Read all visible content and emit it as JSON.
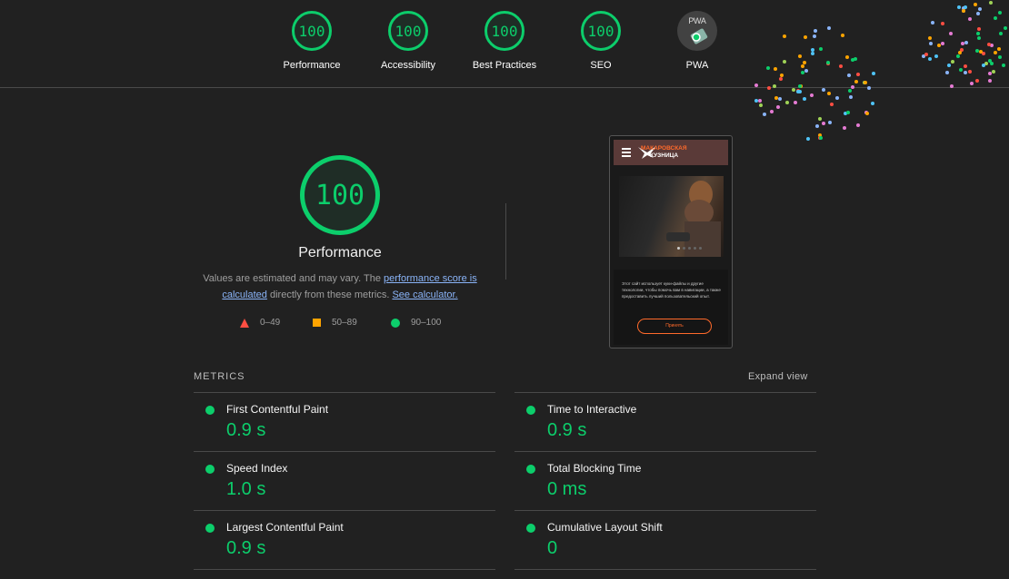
{
  "top_scores": [
    {
      "score": "100",
      "label": "Performance"
    },
    {
      "score": "100",
      "label": "Accessibility"
    },
    {
      "score": "100",
      "label": "Best Practices"
    },
    {
      "score": "100",
      "label": "SEO"
    }
  ],
  "pwa": {
    "label": "PWA",
    "badge_text": "PWA"
  },
  "performance": {
    "score": "100",
    "title": "Performance",
    "desc_prefix": "Values are estimated and may vary. The ",
    "desc_link1": "performance score is calculated",
    "desc_mid": " directly from these metrics. ",
    "desc_link2": "See calculator."
  },
  "legend": {
    "fail": "0–49",
    "average": "50–89",
    "pass": "90–100"
  },
  "screenshot": {
    "brand_line1": "МАКАРОВСКАЯ",
    "brand_line2": "КУЗНИЦА",
    "cookie_text": "Этот сайт использует куки-файлы и другие технологии, чтобы помочь вам в навигации, а также предоставить лучший пользовательский опыт.",
    "accept_label": "Принять"
  },
  "metrics": {
    "heading": "METRICS",
    "expand_label": "Expand view",
    "left": [
      {
        "name": "First Contentful Paint",
        "value": "0.9 s"
      },
      {
        "name": "Speed Index",
        "value": "1.0 s"
      },
      {
        "name": "Largest Contentful Paint",
        "value": "0.9 s"
      }
    ],
    "right": [
      {
        "name": "Time to Interactive",
        "value": "0.9 s"
      },
      {
        "name": "Total Blocking Time",
        "value": "0 ms"
      },
      {
        "name": "Cumulative Layout Shift",
        "value": "0"
      }
    ]
  },
  "colors": {
    "pass": "#0cce6b",
    "average": "#ffa400",
    "fail": "#ff4e42",
    "background": "#212121"
  }
}
